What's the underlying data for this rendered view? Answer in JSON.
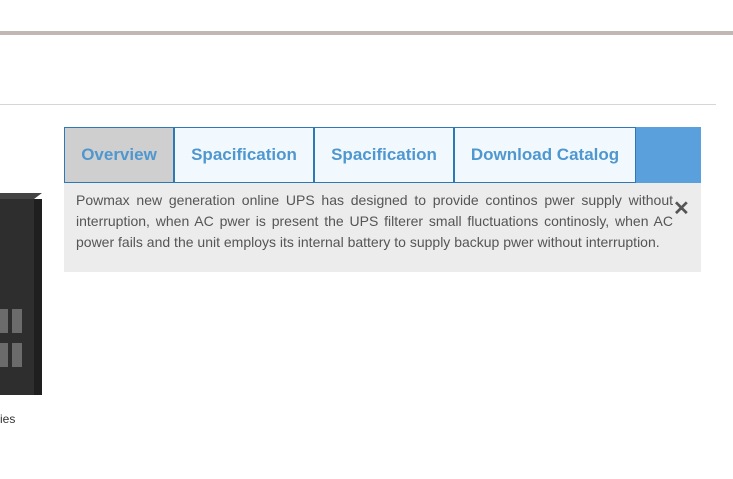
{
  "tabs": [
    {
      "label": "Overview",
      "active": true
    },
    {
      "label": "Spacification",
      "active": false
    },
    {
      "label": "Spacification",
      "active": false
    },
    {
      "label": "Download Catalog",
      "active": false
    }
  ],
  "panel": {
    "text": "Powmax new generation online UPS has designed to provide continos pwer supply without interruption, when AC pwer is present the UPS filterer small fluctuations continosly, when AC power fails and the unit employs its internal battery to supply backup pwer without interruption.",
    "close_glyph": "✕"
  },
  "product": {
    "caption": "ies"
  },
  "colors": {
    "tab_bar": "#5aa0dc",
    "tab_text": "#4f97cf",
    "active_tab_bg": "#cfcfcf",
    "panel_bg": "#ececec",
    "top_bar": "#c1b8b3"
  }
}
